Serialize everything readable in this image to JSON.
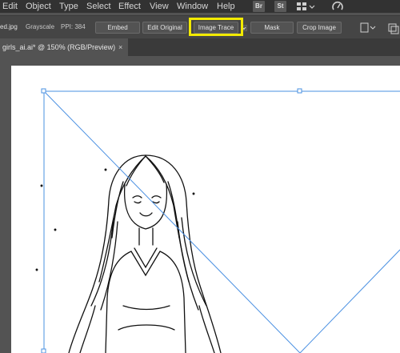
{
  "menu": {
    "items": [
      "Edit",
      "Object",
      "Type",
      "Select",
      "Effect",
      "View",
      "Window",
      "Help"
    ],
    "bridge_label": "Br",
    "stock_label": "St"
  },
  "control_bar": {
    "filename": "ed.jpg",
    "color_mode": "Grayscale",
    "ppi": "PPI: 384",
    "embed_label": "Embed",
    "edit_original_label": "Edit Original",
    "image_trace_label": "Image Trace",
    "mask_label": "Mask",
    "crop_image_label": "Crop Image"
  },
  "document_tab": {
    "title": "girls_ai.ai* @ 150% (RGB/Preview)",
    "close_glyph": "×"
  },
  "colors": {
    "highlight": "#f2ea00",
    "selection": "#4a90e2"
  }
}
